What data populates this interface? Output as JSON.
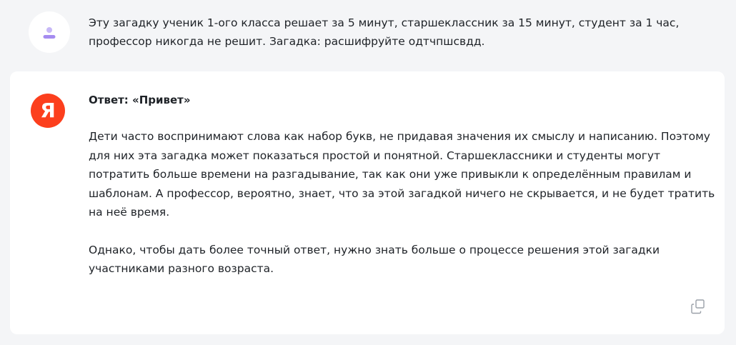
{
  "user_message": {
    "avatar_icon": "user-icon",
    "text": "Эту загадку ученик 1-ого класса решает за 5 минут, старшеклассник за 15 минут, студент за 1 час, профессор никогда не решит. Загадка: расшифруйте одтчпшсвдд."
  },
  "answer": {
    "avatar_letter": "Я",
    "avatar_color": "#fc3f1d",
    "title": "Ответ: «Привет»",
    "paragraphs": [
      "Дети часто воспринимают слова как набор букв, не придавая значения их смыслу и написанию. Поэтому для них эта загадка может показаться простой и понятной. Старшеклассники и студенты могут потратить больше времени на разгадывание, так как они уже привыкли к определённым правилам и шаблонам. А профессор, вероятно, знает, что за этой загадкой ничего не скрывается, и не будет тратить на неё время.",
      "Однако, чтобы дать более точный ответ, нужно знать больше о процессе решения этой загадки участниками разного возраста."
    ],
    "copy_icon": "copy-icon"
  },
  "colors": {
    "background": "#f4f5f7",
    "card": "#ffffff",
    "user_icon": "#a58cf0"
  }
}
